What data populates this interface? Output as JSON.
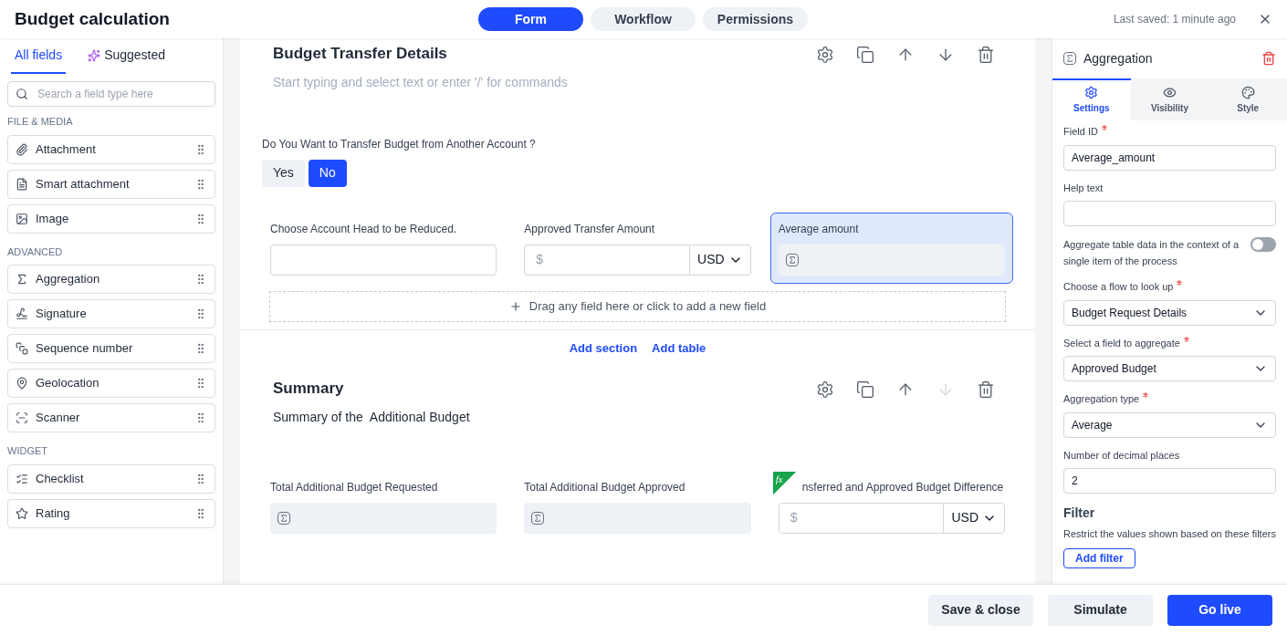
{
  "header": {
    "title": "Budget calculation",
    "tabs": [
      {
        "label": "Form",
        "selected": true
      },
      {
        "label": "Workflow",
        "selected": false
      },
      {
        "label": "Permissions",
        "selected": false
      }
    ],
    "last_saved": "Last saved: 1 minute ago"
  },
  "sidebar": {
    "tabs": [
      {
        "label": "All fields",
        "kind": "plain",
        "selected": true
      },
      {
        "label": "Suggested",
        "kind": "ai",
        "selected": false
      }
    ],
    "search": {
      "placeholder": "Search a field type here"
    },
    "groups": [
      {
        "title": "FILE & MEDIA",
        "items": [
          {
            "label": "Attachment",
            "kind": "attachment"
          },
          {
            "label": "Smart attachment",
            "kind": "smart"
          },
          {
            "label": "Image",
            "kind": "image"
          }
        ]
      },
      {
        "title": "ADVANCED",
        "items": [
          {
            "label": "Aggregation",
            "kind": "aggregation"
          },
          {
            "label": "Signature",
            "kind": "signature"
          },
          {
            "label": "Sequence number",
            "kind": "sequence"
          },
          {
            "label": "Geolocation",
            "kind": "geolocation"
          },
          {
            "label": "Scanner",
            "kind": "scanner"
          }
        ]
      },
      {
        "title": "WIDGET",
        "items": [
          {
            "label": "Checklist",
            "kind": "checklist"
          },
          {
            "label": "Rating",
            "kind": "rating"
          }
        ]
      }
    ]
  },
  "canvas": {
    "sections": [
      {
        "title": "Budget Transfer Details",
        "description_placeholder": "Start typing and select text or enter '/' for commands",
        "actions": [
          {
            "kind": "settings",
            "disabled": false
          },
          {
            "kind": "copy",
            "disabled": false
          },
          {
            "kind": "up",
            "disabled": false
          },
          {
            "kind": "down",
            "disabled": false
          },
          {
            "kind": "delete",
            "disabled": false
          }
        ],
        "question": {
          "label": "Do You Want to Transfer Budget from Another Account ?",
          "options": [
            {
              "label": "Yes",
              "selected": false
            },
            {
              "label": "No",
              "selected": true
            }
          ]
        },
        "fields": [
          {
            "kind": "text",
            "label": "Choose Account Head to be Reduced.",
            "selected": false
          },
          {
            "kind": "currency",
            "label": "Approved Transfer Amount",
            "placeholder": "$",
            "currency": "USD",
            "selected": false
          },
          {
            "kind": "aggregation",
            "label": "Average amount",
            "selected": true
          }
        ],
        "drop_zone": "Drag any field here or click to add a new field"
      },
      {
        "title": "Summary",
        "description": "Summary of the  Additional Budget",
        "actions": [
          {
            "kind": "settings",
            "disabled": false
          },
          {
            "kind": "copy",
            "disabled": false
          },
          {
            "kind": "up",
            "disabled": false
          },
          {
            "kind": "down",
            "disabled": true
          },
          {
            "kind": "delete",
            "disabled": false
          }
        ],
        "fields": [
          {
            "kind": "aggregation",
            "label": "Total Additional Budget Requested",
            "selected": false
          },
          {
            "kind": "aggregation",
            "label": "Total Additional Budget Approved",
            "selected": false
          },
          {
            "kind": "currency",
            "label": "nsferred and Approved Budget Difference",
            "placeholder": "$",
            "currency": "USD",
            "selected": false,
            "formula_badge": "fx"
          }
        ]
      }
    ],
    "add_links": [
      "Add section",
      "Add table"
    ]
  },
  "properties": {
    "title": "Aggregation",
    "tabs": [
      {
        "label": "Settings",
        "kind": "settings",
        "selected": true
      },
      {
        "label": "Visibility",
        "kind": "visibility",
        "selected": false
      },
      {
        "label": "Style",
        "kind": "style",
        "selected": false
      }
    ],
    "fields": [
      {
        "kind": "text",
        "label": "Field ID",
        "required": true,
        "value": "Average_amount"
      },
      {
        "kind": "text",
        "label": "Help text",
        "required": false
      },
      {
        "kind": "toggle",
        "label": "Aggregate table data in the context of a single item of the process",
        "on": false
      },
      {
        "kind": "select",
        "label": "Choose a flow to look up",
        "required": true,
        "value": "Budget Request Details"
      },
      {
        "kind": "select",
        "label": "Select a field to aggregate",
        "required": true,
        "value": "Approved Budget"
      },
      {
        "kind": "select",
        "label": "Aggregation type",
        "required": true,
        "value": "Average"
      },
      {
        "kind": "text",
        "label": "Number of decimal places",
        "required": false,
        "value": "2"
      }
    ],
    "filter": {
      "title": "Filter",
      "description": "Restrict the values shown based on these filters",
      "button": "Add filter"
    }
  },
  "footer": {
    "buttons": [
      {
        "label": "Save & close",
        "kind": "secondary"
      },
      {
        "label": "Simulate",
        "kind": "secondary"
      },
      {
        "label": "Go live",
        "kind": "primary"
      }
    ]
  }
}
